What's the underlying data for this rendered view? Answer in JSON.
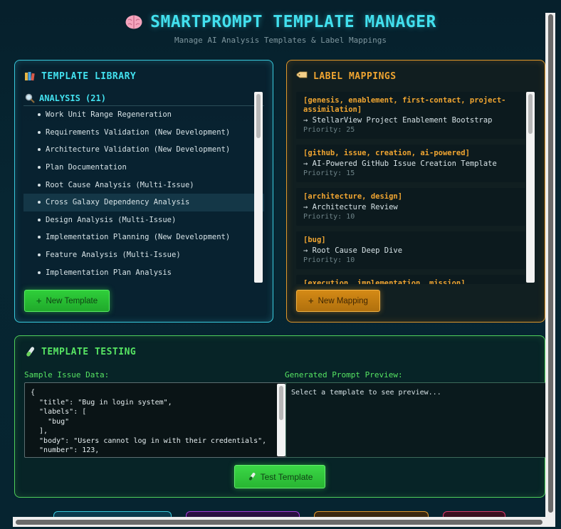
{
  "header": {
    "title": "SMARTPROMPT TEMPLATE MANAGER",
    "subtitle": "Manage AI Analysis Templates & Label Mappings",
    "icon": "brain-icon"
  },
  "library": {
    "title": "TEMPLATE LIBRARY",
    "icon": "books-icon",
    "category": {
      "label": "ANALYSIS (21)",
      "icon": "magnifier-icon"
    },
    "items": [
      "Work Unit Range Regeneration",
      "Requirements Validation (New Development)",
      "Architecture Validation (New Development)",
      "Plan Documentation",
      "Root Cause Analysis (Multi-Issue)",
      "Cross Galaxy Dependency Analysis",
      "Design Analysis (Multi-Issue)",
      "Implementation Planning (New Development)",
      "Feature Analysis (Multi-Issue)",
      "Implementation Plan Analysis"
    ],
    "active_index": 5,
    "new_button": "New Template"
  },
  "mappings": {
    "title": "LABEL MAPPINGS",
    "icon": "label-tag-icon",
    "items": [
      {
        "labels": "[genesis, enablement, first-contact, project-assimilation]",
        "target": "→ StellarView Project Enablement Bootstrap",
        "priority": "Priority: 25"
      },
      {
        "labels": "[github, issue, creation, ai-powered]",
        "target": "→ AI-Powered GitHub Issue Creation Template",
        "priority": "Priority: 15"
      },
      {
        "labels": "[architecture, design]",
        "target": "→ Architecture Review",
        "priority": "Priority: 10"
      },
      {
        "labels": "[bug]",
        "target": "→ Root Cause Deep Dive",
        "priority": "Priority: 10"
      },
      {
        "labels": "[execution, implementation, mission]",
        "target": "",
        "priority": ""
      }
    ],
    "new_button": "New Mapping"
  },
  "testing": {
    "title": "TEMPLATE TESTING",
    "icon": "test-tube-icon",
    "sample_label": "Sample Issue Data:",
    "sample_value": "{\n  \"title\": \"Bug in login system\",\n  \"labels\": [\n    \"bug\"\n  ],\n  \"body\": \"Users cannot log in with their credentials\",\n  \"number\": 123,",
    "preview_label": "Generated Prompt Preview:",
    "preview_value": "Select a template to see preview...",
    "test_button": "Test Template"
  },
  "colors": {
    "cyan": "#42e0ee",
    "orange": "#f0a531",
    "green": "#56e463",
    "bg": "#06202c"
  }
}
